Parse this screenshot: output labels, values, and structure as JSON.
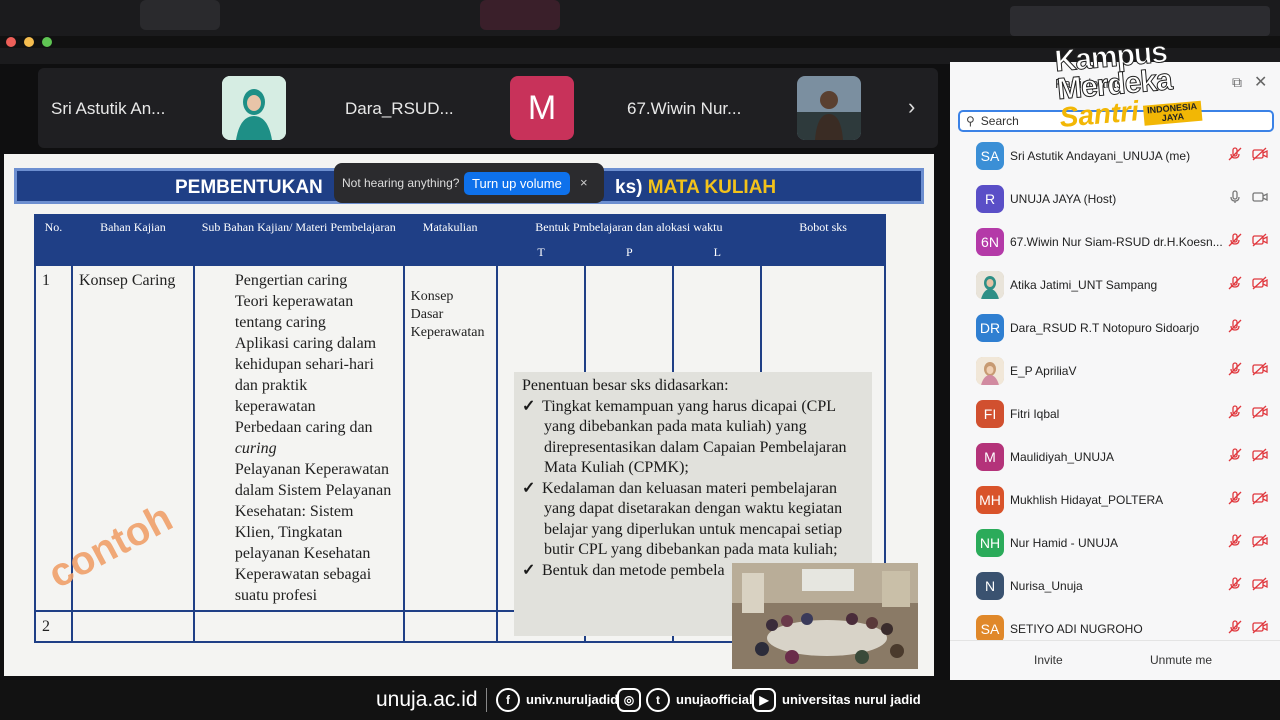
{
  "strip": {
    "tiles": [
      {
        "name": "Sri Astutik An...",
        "thumb": "photo"
      },
      {
        "name": "Dara_RSUD...",
        "thumb": "M"
      },
      {
        "name": "67.Wiwin Nur...",
        "thumb": "photo"
      }
    ],
    "next_icon": "chevron-right-icon"
  },
  "toast": {
    "text": "Not hearing anything?",
    "button": "Turn up volume",
    "close": "×"
  },
  "slide": {
    "title_left": "PEMBENTUKAN",
    "title_right_prefix": "ks)",
    "title_right_bold": "MATA KULIAH",
    "headers": {
      "no": "No.",
      "bahan": "Bahan Kajian",
      "sub": "Sub Bahan Kajian/ Materi Pembelajaran",
      "matakuliah": "Matakulian",
      "bentuk": "Bentuk Pmbelajaran dan alokasi waktu",
      "bobot": "Bobot sks",
      "t": "T",
      "p": "P",
      "l": "L"
    },
    "row1": {
      "no": "1",
      "bahan": "Konsep Caring",
      "sub_items": [
        "Pengertian caring",
        "Teori keperawatan",
        "tentang caring",
        "Aplikasi caring dalam",
        "kehidupan sehari-hari",
        "dan praktik",
        "keperawatan",
        "Perbedaan caring dan",
        "curing",
        "Pelayanan Keperawatan",
        "dalam Sistem Pelayanan",
        "Kesehatan: Sistem",
        "Klien, Tingkatan",
        "pelayanan Kesehatan",
        "Keperawatan sebagai",
        "suatu profesi"
      ],
      "matakuliah": [
        "Konsep",
        "Dasar",
        "Keperawatan"
      ]
    },
    "row2": {
      "no": "2"
    },
    "watermark": "contoh",
    "note": {
      "heading": "Penentuan besar sks didasarkan:",
      "items": [
        [
          "Tingkat kemampuan yang harus dicapai (CPL",
          "yang dibebankan pada mata kuliah) yang",
          "direpresentasikan dalam Capaian Pembelajaran",
          "Mata Kuliah (CPMK);"
        ],
        [
          "Kedalaman dan keluasan materi pembelajaran",
          "yang dapat disetarakan dengan waktu kegiatan",
          "belajar yang diperlukan untuk mencapai setiap",
          "butir CPL yang dibebankan pada mata kuliah;"
        ],
        [
          "Bentuk dan metode pembela"
        ]
      ],
      "check": "✓"
    }
  },
  "panel": {
    "title": "Participants",
    "search_placeholder": "Search",
    "participants": [
      {
        "initials": "SA",
        "color": "#3b8fd6",
        "name": "Sri Astutik Andayani_UNUJA (me)",
        "mic": "muted",
        "cam": "muted"
      },
      {
        "initials": "R",
        "color": "#5a4fc7",
        "name": "UNUJA JAYA (Host)",
        "mic": "on",
        "cam": "on"
      },
      {
        "initials": "6N",
        "color": "#b43aa8",
        "name": "67.Wiwin Nur Siam-RSUD dr.H.Koesn...",
        "mic": "muted",
        "cam": "muted"
      },
      {
        "initials": "",
        "color": "#c9b99a",
        "name": "Atika Jatimi_UNT Sampang",
        "mic": "muted",
        "cam": "muted"
      },
      {
        "initials": "DR",
        "color": "#2f7fd1",
        "name": "Dara_RSUD R.T Notopuro Sidoarjo",
        "mic": "muted",
        "cam": ""
      },
      {
        "initials": "",
        "color": "#d8c3a5",
        "name": "E_P ApriliaV",
        "mic": "muted",
        "cam": "muted"
      },
      {
        "initials": "FI",
        "color": "#d1502f",
        "name": "Fitri Iqbal",
        "mic": "muted",
        "cam": "muted"
      },
      {
        "initials": "M",
        "color": "#b4337a",
        "name": "Maulidiyah_UNUJA",
        "mic": "muted",
        "cam": "muted"
      },
      {
        "initials": "MH",
        "color": "#d9532a",
        "name": "Mukhlish Hidayat_POLTERA",
        "mic": "muted",
        "cam": "muted"
      },
      {
        "initials": "NH",
        "color": "#2bab5a",
        "name": "Nur Hamid - UNUJA",
        "mic": "muted",
        "cam": "muted"
      },
      {
        "initials": "N",
        "color": "#3a5270",
        "name": "Nurisa_Unuja",
        "mic": "muted",
        "cam": "muted"
      },
      {
        "initials": "SA",
        "color": "#e0882a",
        "name": "SETIYO ADI NUGROHO",
        "mic": "muted",
        "cam": "muted"
      }
    ],
    "invite": "Invite",
    "unmute_me": "Unmute me"
  },
  "logo": {
    "line1": "Kampus",
    "line2": "Merdeka",
    "line3": "Santri",
    "badge_top": "INDONESIA",
    "badge_bottom": "JAYA"
  },
  "footer": {
    "site": "unuja.ac.id",
    "facebook": "univ.nuruljadid",
    "social": "unujaofficial",
    "youtube": "universitas nurul jadid"
  },
  "colors": {
    "accent_blue": "#0e71eb",
    "slide_navy": "#1f3f86",
    "muted_red": "#e0383e",
    "logo_yellow": "#f2b705"
  }
}
